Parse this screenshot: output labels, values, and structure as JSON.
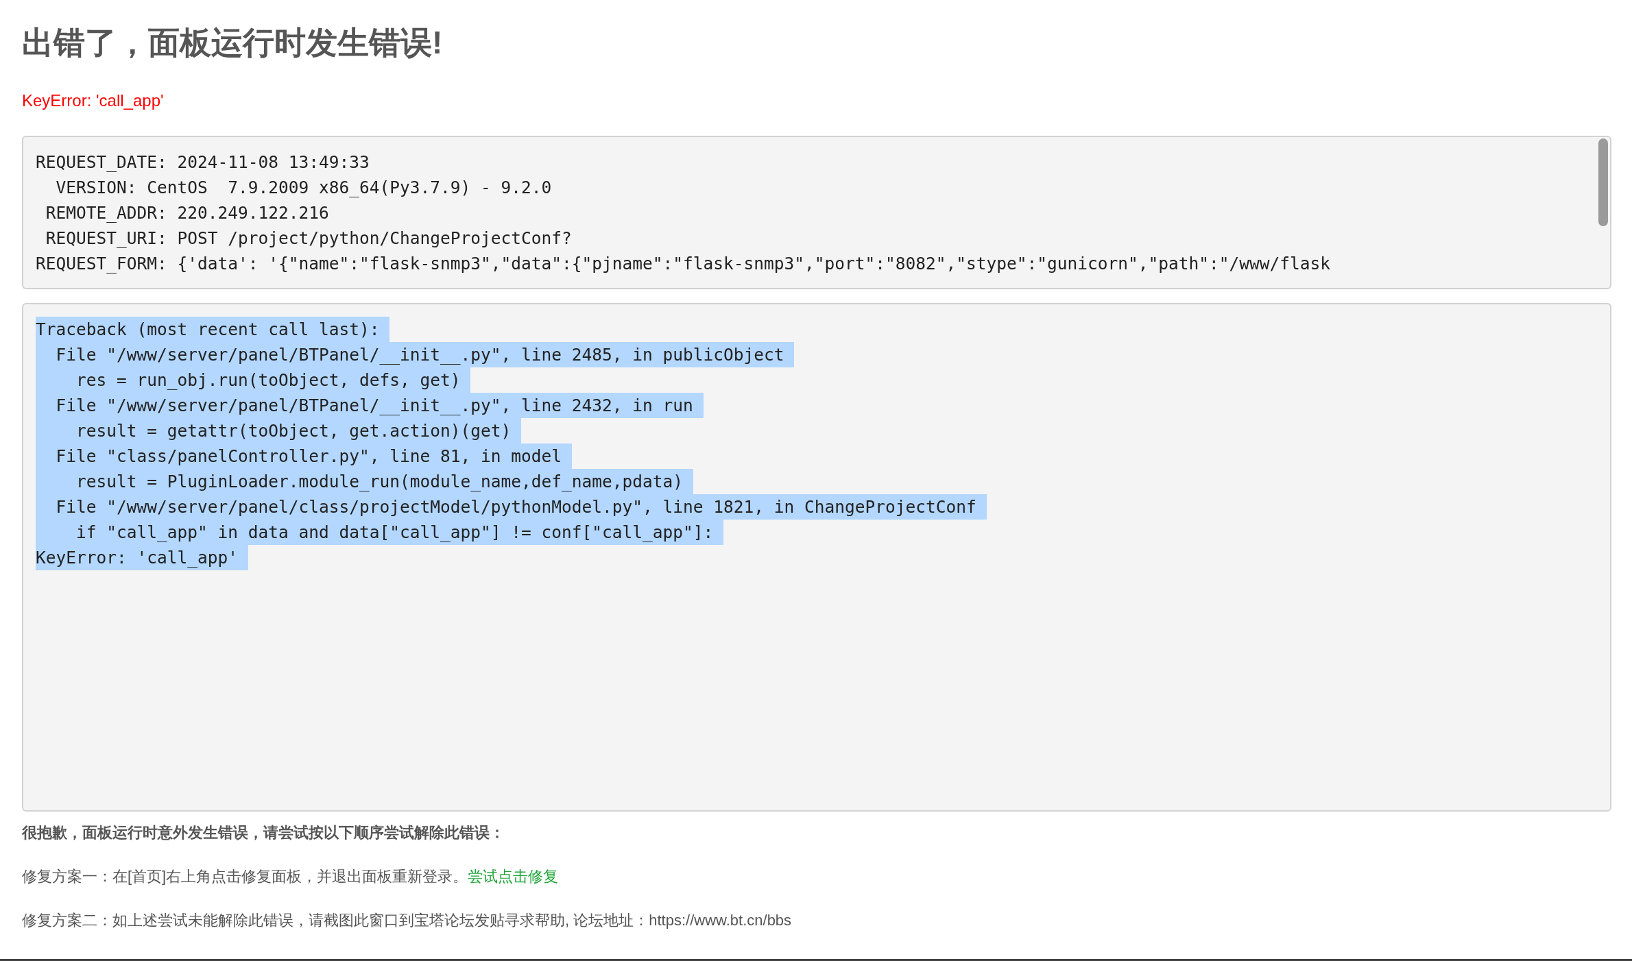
{
  "title": "出错了，面板运行时发生错误!",
  "error_message": "KeyError: 'call_app'",
  "request_info": {
    "lines": [
      "REQUEST_DATE: 2024-11-08 13:49:33",
      "  VERSION: CentOS  7.9.2009 x86_64(Py3.7.9) - 9.2.0",
      " REMOTE_ADDR: 220.249.122.216",
      " REQUEST_URI: POST /project/python/ChangeProjectConf?",
      "REQUEST_FORM: {'data': '{\"name\":\"flask-snmp3\",\"data\":{\"pjname\":\"flask-snmp3\",\"port\":\"8082\",\"stype\":\"gunicorn\",\"path\":\"/www/flask"
    ]
  },
  "traceback": {
    "lines": [
      {
        "text": "Traceback (most recent call last):",
        "selected": true
      },
      {
        "text": "  File \"/www/server/panel/BTPanel/__init__.py\", line 2485, in publicObject",
        "selected": true
      },
      {
        "text": "    res = run_obj.run(toObject, defs, get)",
        "selected": true
      },
      {
        "text": "  File \"/www/server/panel/BTPanel/__init__.py\", line 2432, in run",
        "selected": true
      },
      {
        "text": "    result = getattr(toObject, get.action)(get)",
        "selected": true
      },
      {
        "text": "  File \"class/panelController.py\", line 81, in model",
        "selected": true
      },
      {
        "text": "    result = PluginLoader.module_run(module_name,def_name,pdata)",
        "selected": true
      },
      {
        "text": "  File \"/www/server/panel/class/projectModel/pythonModel.py\", line 1821, in ChangeProjectConf",
        "selected": true
      },
      {
        "text": "    if \"call_app\" in data and data[\"call_app\"] != conf[\"call_app\"]:",
        "selected": true
      },
      {
        "text": "KeyError: 'call_app'",
        "selected": true
      }
    ]
  },
  "help": {
    "heading": "很抱歉，面板运行时意外发生错误，请尝试按以下顺序尝试解除此错误：",
    "fix_1": {
      "text": "修复方案一：在[首页]右上角点击修复面板，并退出面板重新登录。",
      "link": "尝试点击修复"
    },
    "fix_2": "修复方案二：如上述尝试未能解除此错误，请截图此窗口到宝塔论坛发贴寻求帮助, 论坛地址：https://www.bt.cn/bbs"
  }
}
